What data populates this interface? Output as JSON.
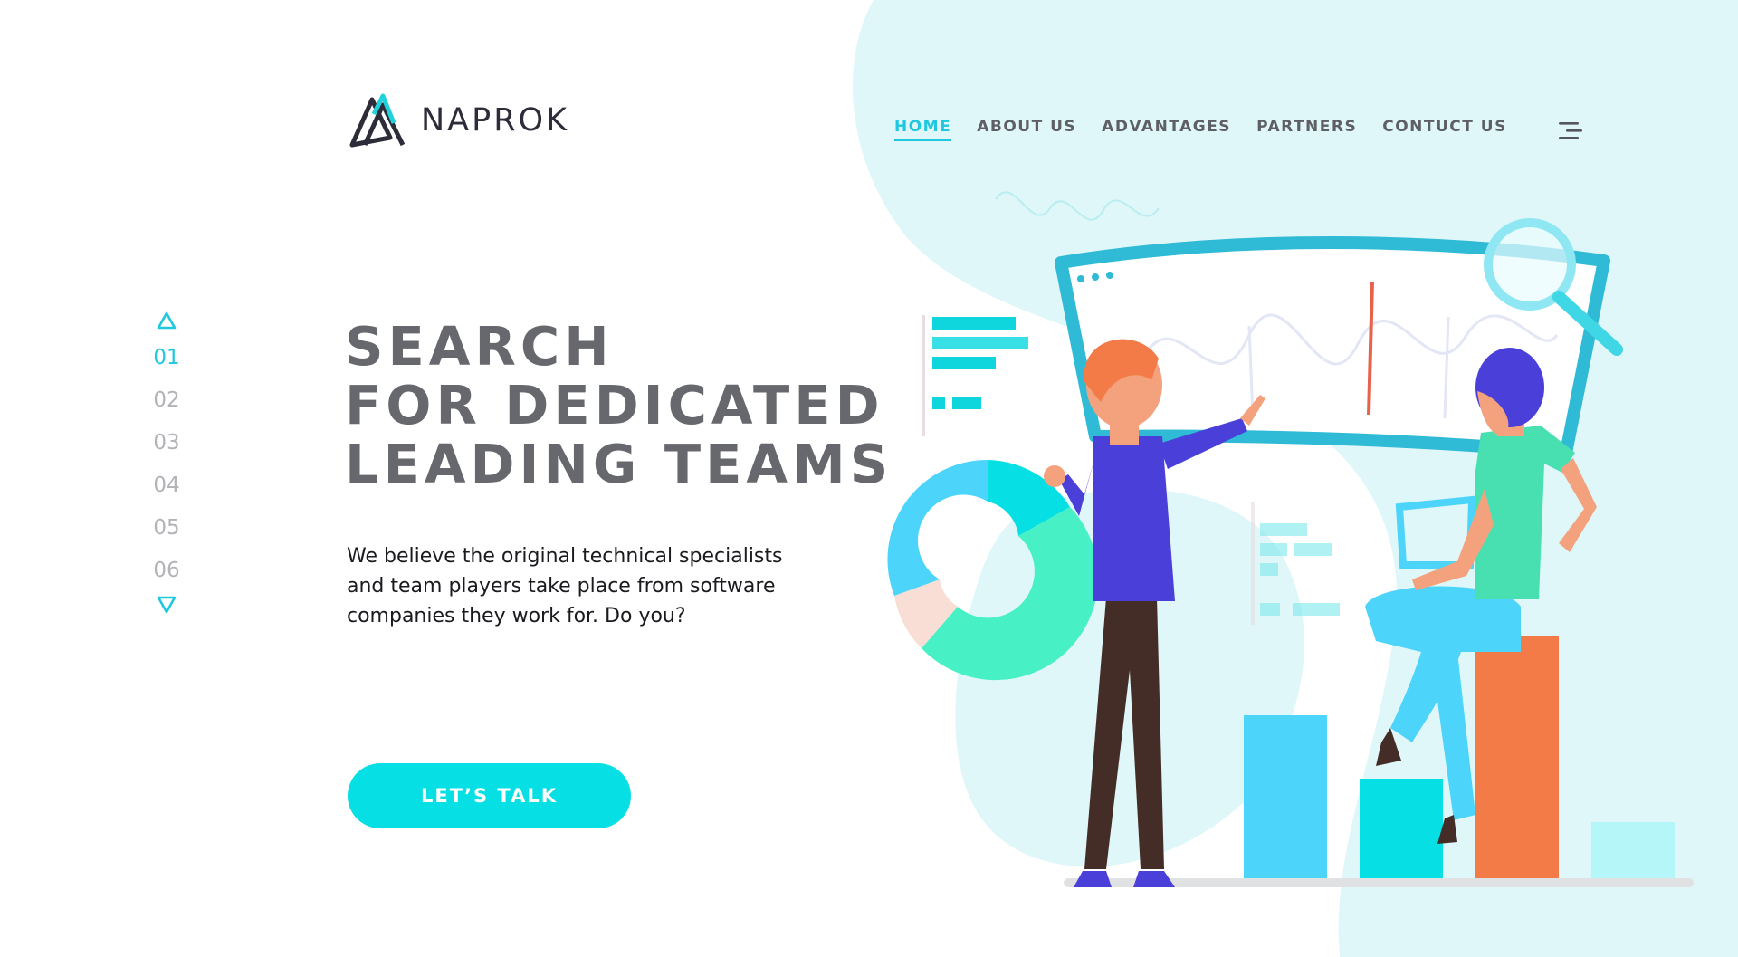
{
  "brand": {
    "name": "NAPROK",
    "accent": "#06dfe4",
    "accent_text": "#1fc7df",
    "heading_color": "#67676e"
  },
  "nav": {
    "items": [
      {
        "label": "HOME",
        "active": true
      },
      {
        "label": "ABOUT US",
        "active": false
      },
      {
        "label": "ADVANTAGES",
        "active": false
      },
      {
        "label": "PARTNERS",
        "active": false
      },
      {
        "label": "CONTUCT US",
        "active": false
      }
    ],
    "menu_icon": "hamburger-menu-icon"
  },
  "pager": {
    "up_icon": "triangle-up-icon",
    "down_icon": "triangle-down-icon",
    "pages": [
      "01",
      "02",
      "03",
      "04",
      "05",
      "06"
    ],
    "active": "01"
  },
  "hero": {
    "title_lines": [
      "SEARCH",
      "FOR DEDICATED",
      "LEADING TEAMS"
    ],
    "text_lines": [
      "We believe the original technical specialists",
      "and team players take place from software",
      "companies they work for. Do you?"
    ],
    "cta_label": "LET’S TALK"
  }
}
